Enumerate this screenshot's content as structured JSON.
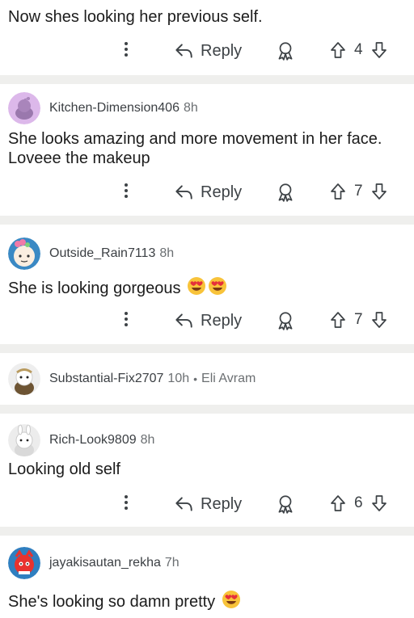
{
  "comments": [
    {
      "body": "Now shes looking her previous self.",
      "reply_label": "Reply",
      "score": "4"
    },
    {
      "username": "Kitchen-Dimension406",
      "time": "8h",
      "body": "She looks amazing and more movement in her face. Loveee the makeup",
      "reply_label": "Reply",
      "score": "7"
    },
    {
      "username": "Outside_Rain7113",
      "time": "8h",
      "body": "She is looking gorgeous",
      "reply_label": "Reply",
      "score": "7"
    },
    {
      "username": "Substantial-Fix2707",
      "time": "10h",
      "flair": "Eli Avram"
    },
    {
      "username": "Rich-Look9809",
      "time": "8h",
      "body": "Looking old self",
      "reply_label": "Reply",
      "score": "6"
    },
    {
      "username": "jayakisautan_rekha",
      "time": "7h",
      "body": "She's looking so damn pretty"
    }
  ],
  "icons": {
    "more": "more-options-icon",
    "reply": "reply-arrow-icon",
    "award": "award-icon",
    "upvote": "upvote-arrow-icon",
    "downvote": "downvote-arrow-icon",
    "emoji": "heart-eyes-emoji"
  },
  "colors": {
    "separator": "#efefed",
    "text": "#1c1c1c",
    "meta": "#6b6f72",
    "icon": "#3d4246"
  }
}
